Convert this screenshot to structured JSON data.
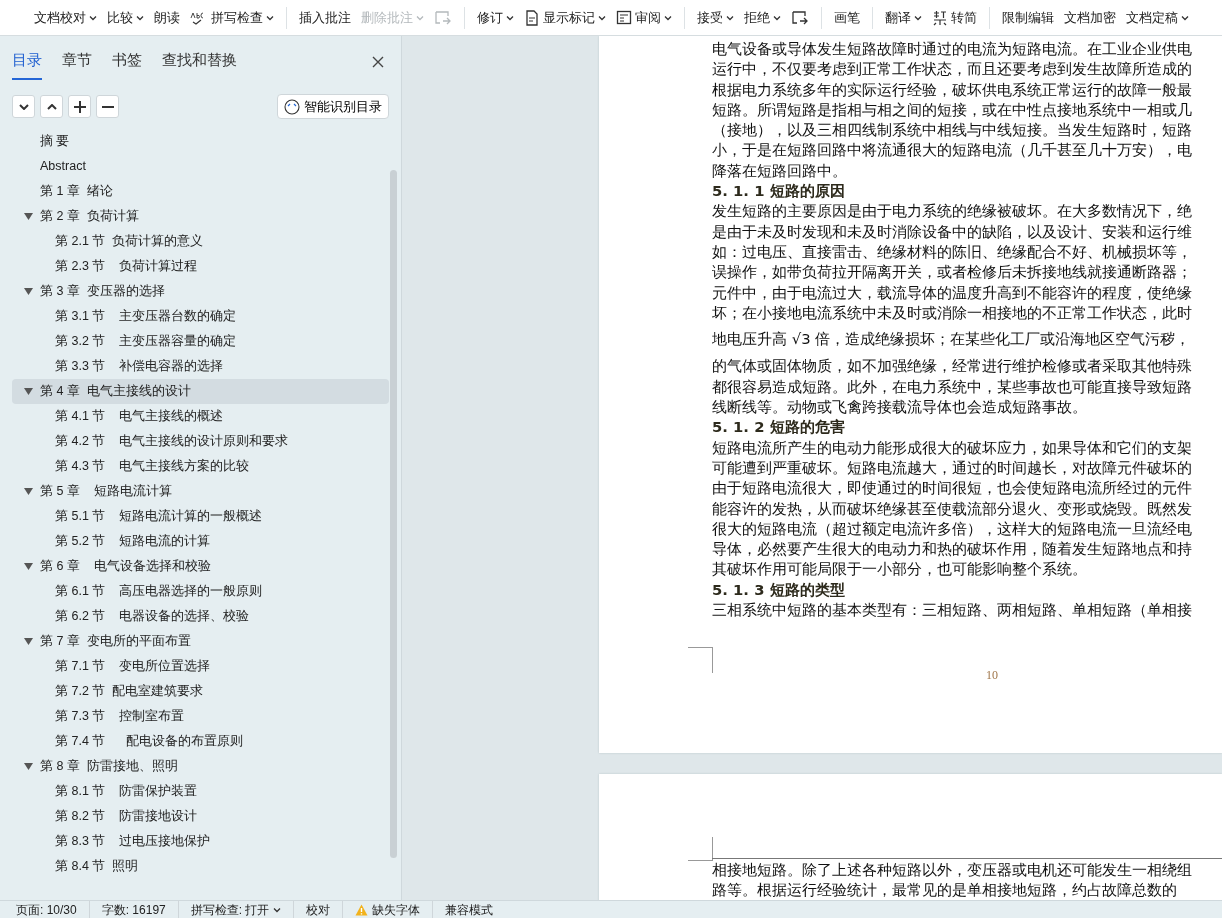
{
  "toolbar": {
    "groups": [
      [
        {
          "kind": "text",
          "label": "文档校对",
          "dropdown": true,
          "disabled": false
        },
        {
          "kind": "text",
          "label": "比较",
          "dropdown": true,
          "disabled": false
        },
        {
          "kind": "text",
          "label": "朗读",
          "dropdown": false,
          "disabled": false
        },
        {
          "kind": "spell",
          "label": "拼写检查",
          "dropdown": true,
          "disabled": false
        }
      ],
      [
        {
          "kind": "text",
          "label": "插入批注",
          "dropdown": false,
          "disabled": false
        },
        {
          "kind": "text",
          "label": "删除批注",
          "dropdown": true,
          "disabled": true
        },
        {
          "kind": "comment",
          "dropdown": false,
          "disabled": true
        }
      ],
      [
        {
          "kind": "text",
          "label": "修订",
          "dropdown": true,
          "disabled": false
        },
        {
          "kind": "markup",
          "label": "显示标记",
          "dropdown": true,
          "disabled": false
        },
        {
          "kind": "review",
          "label": "审阅",
          "dropdown": true,
          "disabled": false
        }
      ],
      [
        {
          "kind": "text",
          "label": "接受",
          "dropdown": true,
          "disabled": false
        },
        {
          "kind": "text",
          "label": "拒绝",
          "dropdown": true,
          "disabled": false
        },
        {
          "kind": "comment",
          "dropdown": false,
          "disabled": false
        }
      ],
      [
        {
          "kind": "text",
          "label": "画笔",
          "dropdown": false,
          "disabled": false
        }
      ],
      [
        {
          "kind": "text",
          "label": "翻译",
          "dropdown": true,
          "disabled": false
        },
        {
          "kind": "simplify",
          "label": "转简",
          "dropdown": false,
          "disabled": false
        }
      ],
      [
        {
          "kind": "text",
          "label": "限制编辑",
          "dropdown": false,
          "disabled": false
        },
        {
          "kind": "text",
          "label": "文档加密",
          "dropdown": false,
          "disabled": false
        },
        {
          "kind": "text",
          "label": "文档定稿",
          "dropdown": true,
          "disabled": false
        }
      ]
    ]
  },
  "sidebar": {
    "tabs": [
      {
        "label": "目录",
        "selected": true
      },
      {
        "label": "章节",
        "selected": false
      },
      {
        "label": "书签",
        "selected": false
      },
      {
        "label": "查找和替换",
        "selected": false
      }
    ],
    "smart_button": {
      "label": "智能识别目录"
    },
    "toc": [
      {
        "label": "摘 要",
        "selected": false
      },
      {
        "label": "Abstract",
        "selected": false
      },
      {
        "label": "第 1 章  绪论",
        "selected": false
      },
      {
        "label": "第 2 章  负荷计算",
        "selected": false,
        "expanded": true,
        "children": [
          {
            "label": "第 2.1 节  负荷计算的意义",
            "selected": false
          },
          {
            "label": "第 2.3 节    负荷计算过程",
            "selected": false
          }
        ]
      },
      {
        "label": "第 3 章  变压器的选择",
        "selected": false,
        "expanded": true,
        "children": [
          {
            "label": "第 3.1 节    主变压器台数的确定",
            "selected": false
          },
          {
            "label": "第 3.2 节    主变压器容量的确定",
            "selected": false
          },
          {
            "label": "第 3.3 节    补偿电容器的选择",
            "selected": false
          }
        ]
      },
      {
        "label": "第 4 章  电气主接线的设计",
        "selected": true,
        "expanded": true,
        "children": [
          {
            "label": "第 4.1 节    电气主接线的概述",
            "selected": false
          },
          {
            "label": "第 4.2 节    电气主接线的设计原则和要求",
            "selected": false
          },
          {
            "label": "第 4.3 节    电气主接线方案的比较",
            "selected": false
          }
        ]
      },
      {
        "label": "第 5 章    短路电流计算",
        "selected": false,
        "expanded": true,
        "children": [
          {
            "label": "第 5.1 节    短路电流计算的一般概述",
            "selected": false
          },
          {
            "label": "第 5.2 节    短路电流的计算",
            "selected": false
          }
        ]
      },
      {
        "label": "第 6 章    电气设备选择和校验",
        "selected": false,
        "expanded": true,
        "children": [
          {
            "label": "第 6.1 节    高压电器选择的一般原则",
            "selected": false
          },
          {
            "label": "第 6.2 节    电器设备的选择、校验",
            "selected": false
          }
        ]
      },
      {
        "label": "第 7 章  变电所的平面布置",
        "selected": false,
        "expanded": true,
        "children": [
          {
            "label": "第 7.1 节    变电所位置选择",
            "selected": false
          },
          {
            "label": "第 7.2 节  配电室建筑要求",
            "selected": false
          },
          {
            "label": "第 7.3 节    控制室布置",
            "selected": false
          },
          {
            "label": "第 7.4 节      配电设备的布置原则",
            "selected": false
          }
        ]
      },
      {
        "label": "第 8 章  防雷接地、照明",
        "selected": false,
        "expanded": true,
        "children": [
          {
            "label": "第 8.1 节    防雷保护装置",
            "selected": false
          },
          {
            "label": "第 8.2 节    防雷接地设计",
            "selected": false
          },
          {
            "label": "第 8.3 节    过电压接地保护",
            "selected": false
          },
          {
            "label": "第 8.4 节  照明",
            "selected": false
          }
        ]
      }
    ]
  },
  "document": {
    "pages": [
      {
        "blocks": [
          {
            "kind": "para",
            "text": "电气设备或导体发生短路故障时通过的电流为短路电流。在工业企业供电"
          },
          {
            "kind": "para",
            "text": "运行中，不仅要考虑到正常工作状态，而且还要考虑到发生故障所造成的"
          },
          {
            "kind": "para",
            "text": "根据电力系统多年的实际运行经验，破坏供电系统正常运行的故障一般最"
          },
          {
            "kind": "para",
            "text": "短路。所谓短路是指相与相之间的短接，或在中性点接地系统中一相或几"
          },
          {
            "kind": "para",
            "text": "（接地），以及三相四线制系统中相线与中线短接。当发生短路时，短路"
          },
          {
            "kind": "para",
            "text": "小，于是在短路回路中将流通很大的短路电流（几千甚至几十万安），电"
          },
          {
            "kind": "para",
            "text": "降落在短路回路中。"
          },
          {
            "kind": "heading",
            "text": "5. 1. 1 短路的原因"
          },
          {
            "kind": "para",
            "text": "发生短路的主要原因是由于电力系统的绝缘被破坏。在大多数情况下，绝"
          },
          {
            "kind": "para",
            "text": "是由于未及时发现和未及时消除设备中的缺陷，以及设计、安装和运行维"
          },
          {
            "kind": "para",
            "text": "如：过电压、直接雷击、绝缘材料的陈旧、绝缘配合不好、机械损坏等，"
          },
          {
            "kind": "para",
            "text": "误操作，如带负荷拉开隔离开关，或者检修后未拆接地线就接通断路器；"
          },
          {
            "kind": "para",
            "text": "元件中，由于电流过大，载流导体的温度升高到不能容许的程度，使绝缘"
          },
          {
            "kind": "para",
            "text": "坏；在小接地电流系统中未及时或消除一相接地的不正常工作状态，此时"
          },
          {
            "kind": "formula",
            "text": "地电压升高 √3 倍，造成绝缘损坏；在某些化工厂或沿海地区空气污秽，"
          },
          {
            "kind": "para",
            "text": "的气体或固体物质，如不加强绝缘，经常进行维护检修或者采取其他特殊"
          },
          {
            "kind": "para",
            "text": "都很容易造成短路。此外，在电力系统中，某些事故也可能直接导致短路"
          },
          {
            "kind": "para",
            "text": "线断线等。动物或飞禽跨接载流导体也会造成短路事故。"
          },
          {
            "kind": "heading",
            "text": "5. 1. 2 短路的危害"
          },
          {
            "kind": "para",
            "text": "短路电流所产生的电动力能形成很大的破坏应力，如果导体和它们的支架"
          },
          {
            "kind": "para",
            "text": "可能遭到严重破坏。短路电流越大，通过的时间越长，对故障元件破坏的"
          },
          {
            "kind": "para",
            "text": "由于短路电流很大，即使通过的时间很短，也会使短路电流所经过的元件"
          },
          {
            "kind": "para",
            "text": "能容许的发热，从而破坏绝缘甚至使载流部分退火、变形或烧毁。既然发"
          },
          {
            "kind": "para",
            "text": "很大的短路电流（超过额定电流许多倍），这样大的短路电流一旦流经电"
          },
          {
            "kind": "para",
            "text": "导体，必然要产生很大的电动力和热的破坏作用，随着发生短路地点和持"
          },
          {
            "kind": "para",
            "text": "其破坏作用可能局限于一小部分，也可能影响整个系统。"
          },
          {
            "kind": "heading",
            "text": "5. 1. 3 短路的类型"
          },
          {
            "kind": "para",
            "text": "三相系统中短路的基本类型有：三相短路、两相短路、单相短路（单相接"
          }
        ],
        "page_number": "10"
      },
      {
        "blocks": [
          {
            "kind": "para",
            "text": "相接地短路。除了上述各种短路以外，变压器或电机还可能发生一相绕组"
          },
          {
            "kind": "para",
            "text": "路等。根据运行经验统计，最常见的是单相接地短路，约占故障总数的"
          }
        ]
      }
    ]
  },
  "status_bar": {
    "items": [
      {
        "kind": "text",
        "label": "页面: 10/30",
        "dropdown": false
      },
      {
        "kind": "text",
        "label": "字数: 16197",
        "dropdown": false
      },
      {
        "kind": "text",
        "label": "拼写检查: 打开",
        "dropdown": true
      },
      {
        "kind": "text",
        "label": "校对",
        "dropdown": false
      },
      {
        "kind": "warning",
        "label": "缺失字体",
        "dropdown": false
      },
      {
        "kind": "text",
        "label": "兼容模式",
        "dropdown": false
      }
    ]
  }
}
